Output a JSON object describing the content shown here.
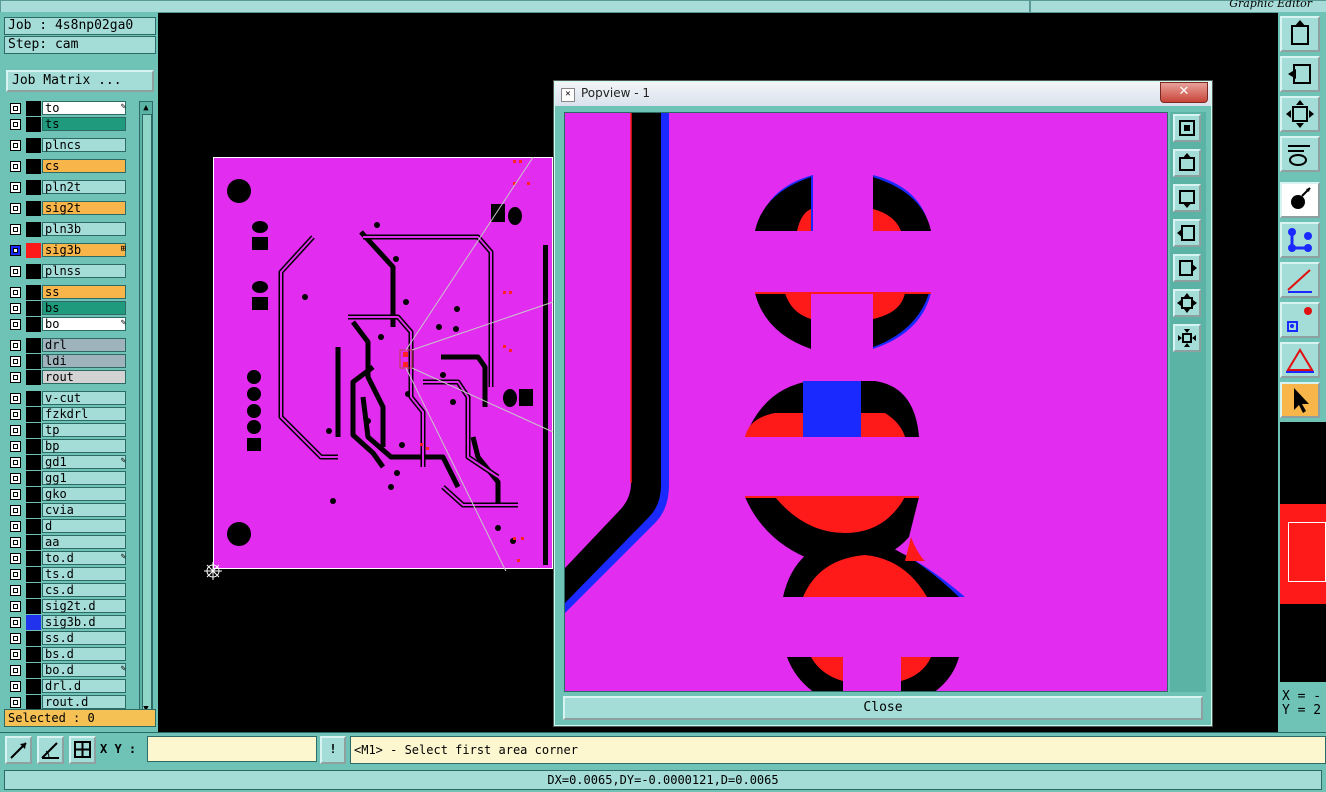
{
  "window": {
    "title": "Graphic Editor"
  },
  "job": {
    "job_label": "Job : 4s8np02ga0",
    "step_label": "Step: cam",
    "job_matrix_button": "Job Matrix ..."
  },
  "layers": [
    {
      "name": "to",
      "bg": "#ffffff",
      "mark": "✎"
    },
    {
      "name": "ts",
      "bg": "#1f9a7c",
      "mark": ""
    },
    {
      "name": "plncs",
      "bg": "#a4dcd7",
      "mark": ""
    },
    {
      "name": "cs",
      "bg": "#f7b54a",
      "mark": ""
    },
    {
      "name": "pln2t",
      "bg": "#a4dcd7",
      "mark": ""
    },
    {
      "name": "sig2t",
      "bg": "#f7b54a",
      "mark": ""
    },
    {
      "name": "pln3b",
      "bg": "#a4dcd7",
      "mark": ""
    },
    {
      "name": "sig3b",
      "bg": "#f7b54a",
      "mark": "⊞",
      "active": true
    },
    {
      "name": "plnss",
      "bg": "#a4dcd7",
      "mark": ""
    },
    {
      "name": "ss",
      "bg": "#f7b54a",
      "mark": ""
    },
    {
      "name": "bs",
      "bg": "#1f9a7c",
      "mark": ""
    },
    {
      "name": "bo",
      "bg": "#ffffff",
      "mark": "✎"
    },
    {
      "name": "drl",
      "bg": "#9fb3bd",
      "mark": ""
    },
    {
      "name": "ldi",
      "bg": "#9fb3bd",
      "mark": ""
    },
    {
      "name": "rout",
      "bg": "#d3d3d3",
      "mark": ""
    },
    {
      "name": "v-cut",
      "bg": "#a4dcd7",
      "mark": ""
    },
    {
      "name": "fzkdrl",
      "bg": "#a4dcd7",
      "mark": ""
    },
    {
      "name": "tp",
      "bg": "#a4dcd7",
      "mark": ""
    },
    {
      "name": "bp",
      "bg": "#a4dcd7",
      "mark": ""
    },
    {
      "name": "gd1",
      "bg": "#a4dcd7",
      "mark": "✎"
    },
    {
      "name": "gg1",
      "bg": "#a4dcd7",
      "mark": ""
    },
    {
      "name": "gko",
      "bg": "#a4dcd7",
      "mark": ""
    },
    {
      "name": "cvia",
      "bg": "#a4dcd7",
      "mark": ""
    },
    {
      "name": "d",
      "bg": "#a4dcd7",
      "mark": ""
    },
    {
      "name": "aa",
      "bg": "#a4dcd7",
      "mark": ""
    },
    {
      "name": "to.d",
      "bg": "#a4dcd7",
      "mark": "✎"
    },
    {
      "name": "ts.d",
      "bg": "#a4dcd7",
      "mark": ""
    },
    {
      "name": "cs.d",
      "bg": "#a4dcd7",
      "mark": ""
    },
    {
      "name": "sig2t.d",
      "bg": "#a4dcd7",
      "mark": ""
    },
    {
      "name": "sig3b.d",
      "bg": "#a4dcd7",
      "mark": "",
      "marker": "#2233ee"
    },
    {
      "name": "ss.d",
      "bg": "#a4dcd7",
      "mark": ""
    },
    {
      "name": "bs.d",
      "bg": "#a4dcd7",
      "mark": ""
    },
    {
      "name": "bo.d",
      "bg": "#a4dcd7",
      "mark": "✎"
    },
    {
      "name": "drl.d",
      "bg": "#a4dcd7",
      "mark": ""
    },
    {
      "name": "rout.d",
      "bg": "#a4dcd7",
      "mark": ""
    }
  ],
  "selected_label": "Selected : 0",
  "popview": {
    "title": "Popview - 1",
    "close_button": "Close",
    "title_close": "✕"
  },
  "bottom": {
    "xy_label": "X Y :",
    "xy_value": "",
    "warn": "!",
    "prompt": "<M1> - Select first area corner"
  },
  "status": "DX=0.0065,DY=-0.0000121,D=0.0065",
  "coords": {
    "x": "X = -",
    "y": "Y = 2"
  },
  "colors": {
    "board": "#e22cf0",
    "panel": "#6ec3b6",
    "copper": "#000000",
    "red": "#ff1a1a",
    "blue": "#1a2aff"
  }
}
